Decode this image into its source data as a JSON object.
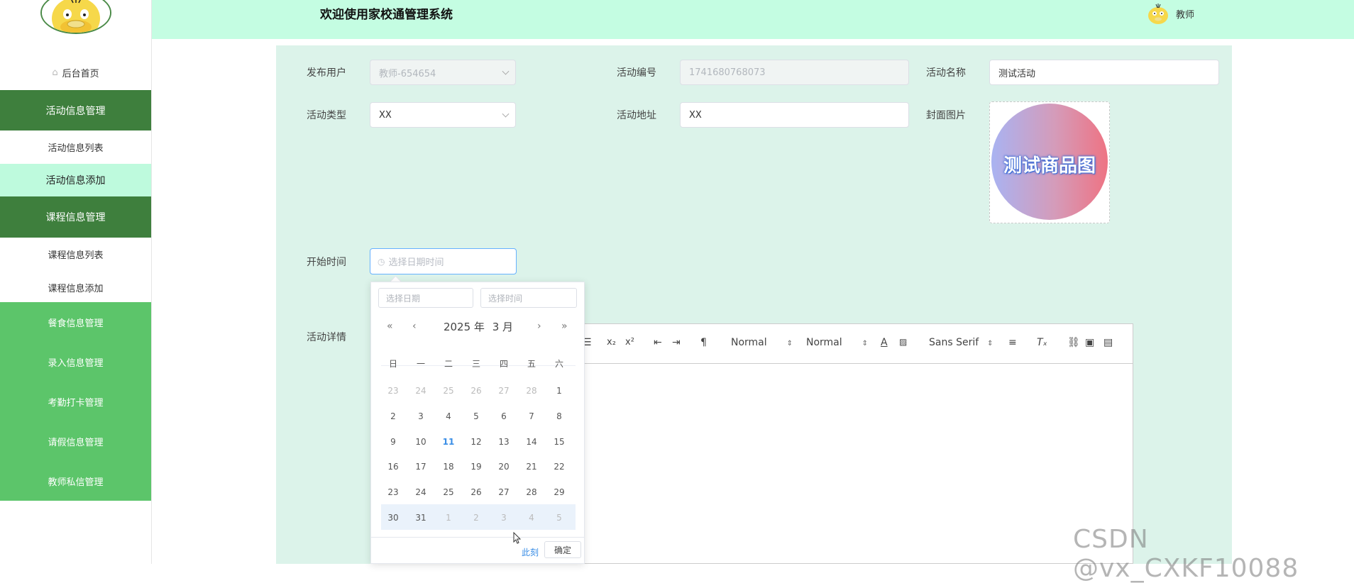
{
  "sidebar": {
    "home_label": "后台首页",
    "menus": [
      {
        "label": "活动信息管理",
        "style": "dark"
      },
      {
        "label": "活动信息列表",
        "style": "white"
      },
      {
        "label": "活动信息添加",
        "style": "mint"
      },
      {
        "label": "课程信息管理",
        "style": "dark"
      },
      {
        "label": "课程信息列表",
        "style": "white"
      },
      {
        "label": "课程信息添加",
        "style": "white"
      },
      {
        "label": "餐食信息管理",
        "style": "green"
      },
      {
        "label": "录入信息管理",
        "style": "green"
      },
      {
        "label": "考勤打卡管理",
        "style": "green"
      },
      {
        "label": "请假信息管理",
        "style": "green"
      },
      {
        "label": "教师私信管理",
        "style": "green"
      }
    ]
  },
  "header": {
    "title": "欢迎使用家校通管理系统",
    "user_name": "教师"
  },
  "form": {
    "publisher": {
      "label": "发布用户",
      "value": "教师-654654"
    },
    "activity_no": {
      "label": "活动编号",
      "value": "1741680768073"
    },
    "activity_name": {
      "label": "活动名称",
      "value": "测试活动"
    },
    "activity_type": {
      "label": "活动类型",
      "value": "XX"
    },
    "activity_address": {
      "label": "活动地址",
      "value": "XX"
    },
    "cover": {
      "label": "封面图片",
      "image_text": "测试商品图"
    },
    "start_time": {
      "label": "开始时间",
      "placeholder": "选择日期时间"
    },
    "details": {
      "label": "活动详情"
    }
  },
  "editor": {
    "header_select": "Normal",
    "size_select": "Normal",
    "font_select": "Sans Serif"
  },
  "datepicker": {
    "date_placeholder": "选择日期",
    "time_placeholder": "选择时间",
    "year_label": "2025 年",
    "month_label": "3 月",
    "weekdays": [
      "日",
      "一",
      "二",
      "三",
      "四",
      "五",
      "六"
    ],
    "weeks": [
      [
        {
          "d": "23",
          "o": true
        },
        {
          "d": "24",
          "o": true
        },
        {
          "d": "25",
          "o": true
        },
        {
          "d": "26",
          "o": true
        },
        {
          "d": "27",
          "o": true
        },
        {
          "d": "28",
          "o": true
        },
        {
          "d": "1",
          "o": false
        }
      ],
      [
        {
          "d": "2",
          "o": false
        },
        {
          "d": "3",
          "o": false
        },
        {
          "d": "4",
          "o": false
        },
        {
          "d": "5",
          "o": false
        },
        {
          "d": "6",
          "o": false
        },
        {
          "d": "7",
          "o": false
        },
        {
          "d": "8",
          "o": false
        }
      ],
      [
        {
          "d": "9",
          "o": false
        },
        {
          "d": "10",
          "o": false
        },
        {
          "d": "11",
          "o": false,
          "today": true
        },
        {
          "d": "12",
          "o": false
        },
        {
          "d": "13",
          "o": false
        },
        {
          "d": "14",
          "o": false
        },
        {
          "d": "15",
          "o": false
        }
      ],
      [
        {
          "d": "16",
          "o": false
        },
        {
          "d": "17",
          "o": false
        },
        {
          "d": "18",
          "o": false
        },
        {
          "d": "19",
          "o": false
        },
        {
          "d": "20",
          "o": false
        },
        {
          "d": "21",
          "o": false
        },
        {
          "d": "22",
          "o": false
        }
      ],
      [
        {
          "d": "23",
          "o": false
        },
        {
          "d": "24",
          "o": false
        },
        {
          "d": "25",
          "o": false
        },
        {
          "d": "26",
          "o": false
        },
        {
          "d": "27",
          "o": false
        },
        {
          "d": "28",
          "o": false
        },
        {
          "d": "29",
          "o": false
        }
      ],
      [
        {
          "d": "30",
          "o": false
        },
        {
          "d": "31",
          "o": false
        },
        {
          "d": "1",
          "o": true
        },
        {
          "d": "2",
          "o": true
        },
        {
          "d": "3",
          "o": true
        },
        {
          "d": "4",
          "o": true
        },
        {
          "d": "5",
          "o": true
        }
      ]
    ],
    "now_label": "此刻",
    "confirm_label": "确定"
  },
  "watermark": "CSDN @vx_CXKF10088",
  "colors": {
    "header_bg": "#c4fde2",
    "menu_dark": "#3e7f3d",
    "menu_green": "#5cc56a",
    "menu_mint": "#befadd",
    "panel_bg": "#dcf3ea",
    "accent_blue": "#3a8ee6"
  }
}
